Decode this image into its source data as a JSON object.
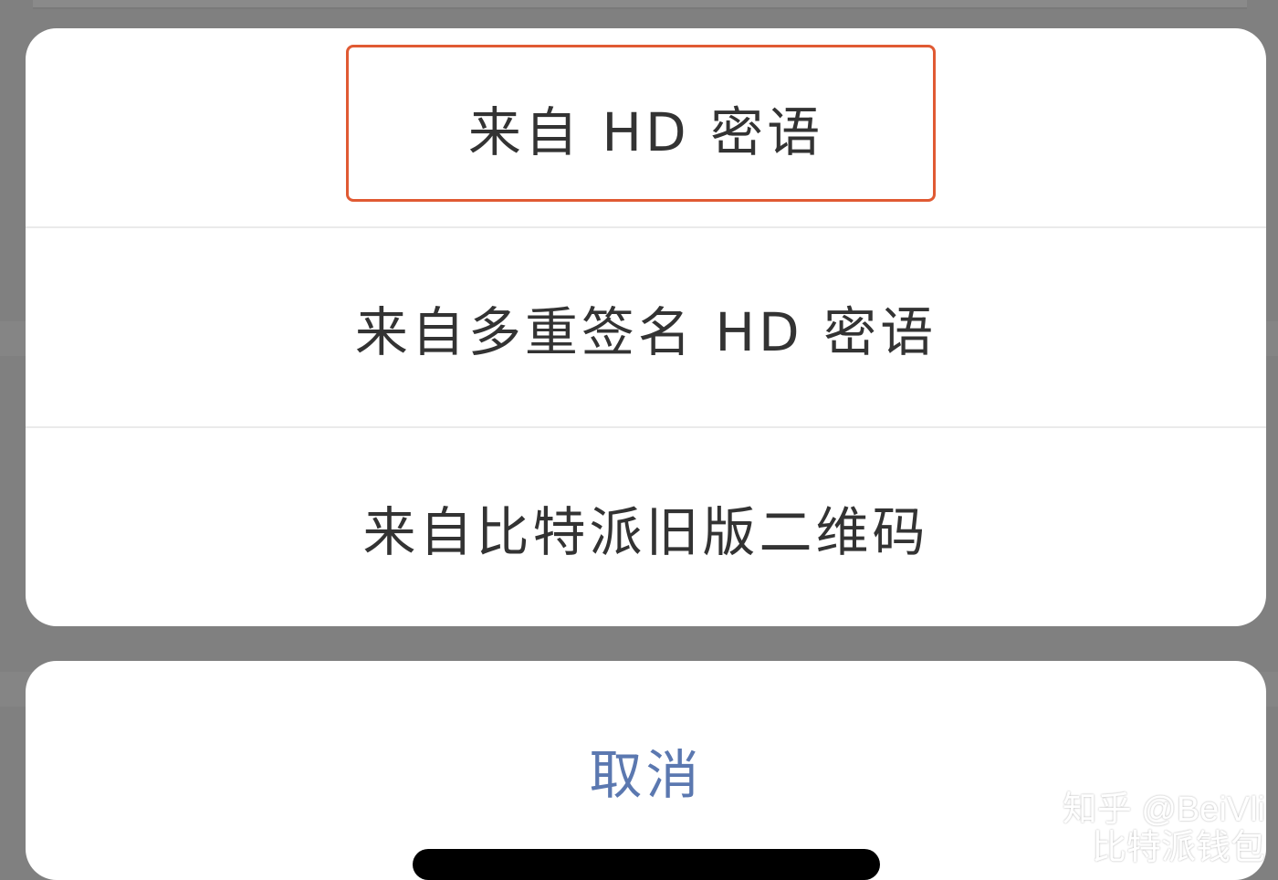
{
  "action_sheet": {
    "options": [
      {
        "label": "来自 HD 密语"
      },
      {
        "label": "来自多重签名 HD 密语"
      },
      {
        "label": "来自比特派旧版二维码"
      }
    ]
  },
  "cancel": {
    "label": "取消"
  },
  "watermark": {
    "line1": "知乎 @BeiVli",
    "line2": "比特派钱包"
  },
  "colors": {
    "highlight_border": "#e05a33",
    "cancel_text": "#5b78b0",
    "option_text": "#333333",
    "overlay": "#808080"
  },
  "icons": {
    "watermark_icon": "weibo-icon"
  }
}
